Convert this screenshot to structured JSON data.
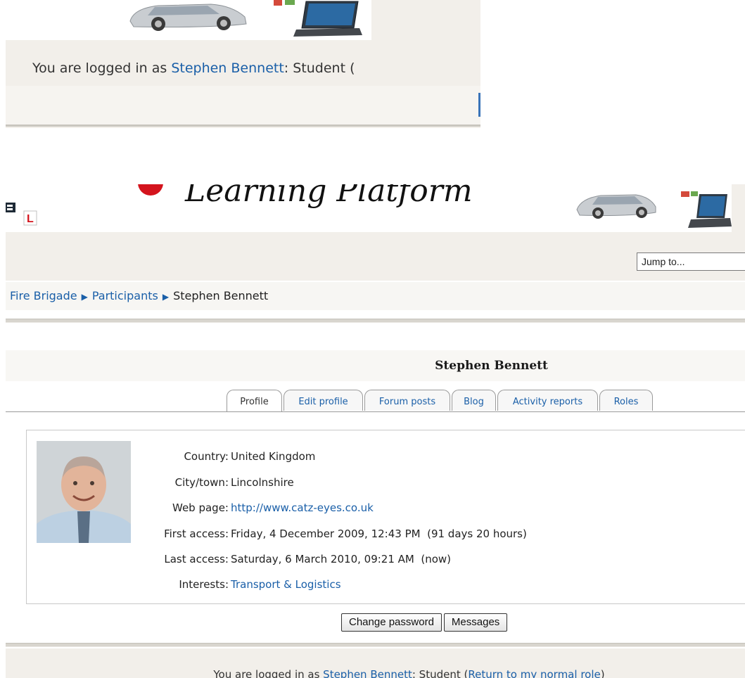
{
  "top_crop": {
    "login_prefix": "You are logged in as ",
    "user_name": "Stephen Bennett",
    "login_suffix": ": Student ("
  },
  "header": {
    "brand_text": "Learning Platform",
    "jump_to": "Jump to..."
  },
  "breadcrumb": {
    "items": [
      "Fire Brigade",
      "Participants"
    ],
    "current": "Stephen Bennett"
  },
  "page_title": "Stephen Bennett",
  "tabs": [
    {
      "label": "Profile"
    },
    {
      "label": "Edit profile"
    },
    {
      "label": "Forum posts"
    },
    {
      "label": "Blog"
    },
    {
      "label": "Activity reports"
    },
    {
      "label": "Roles"
    }
  ],
  "profile": {
    "fields": [
      {
        "label": "Country:",
        "value": "United Kingdom"
      },
      {
        "label": "City/town:",
        "value": "Lincolnshire"
      },
      {
        "label": "Web page:",
        "value": "http://www.catz-eyes.co.uk"
      },
      {
        "label": "First access:",
        "value": "Friday, 4 December 2009, 12:43 PM  (91 days 20 hours)"
      },
      {
        "label": "Last access:",
        "value": "Saturday, 6 March 2010, 09:21 AM  (now)"
      },
      {
        "label": "Interests:",
        "value": "Transport & Logistics"
      }
    ]
  },
  "buttons": {
    "change_password": "Change password",
    "messages": "Messages"
  },
  "footer": {
    "login_prefix": "You are logged in as ",
    "user_name": "Stephen Bennett",
    "role_text": ": Student (",
    "return_link": "Return to my normal role",
    "close": ")"
  },
  "colors": {
    "link": "#1a5fa8",
    "band": "#f2efea",
    "brand_red": "#d4141d"
  }
}
